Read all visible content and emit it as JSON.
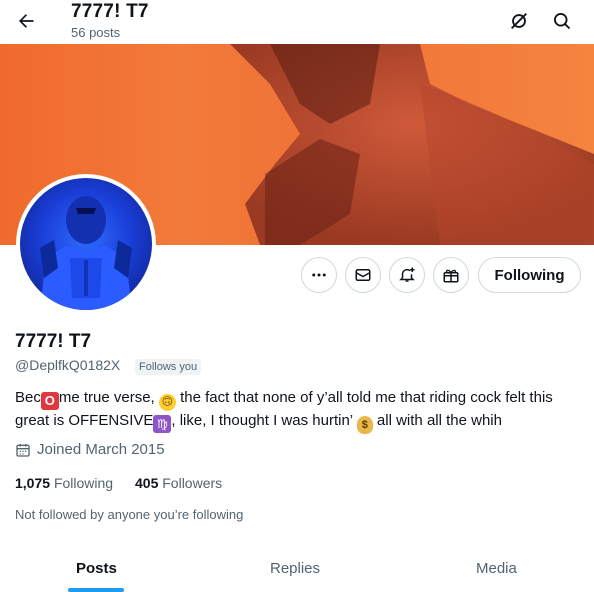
{
  "header": {
    "title": "7777! T7",
    "subtitle": "56 posts",
    "back_icon": "arrow-left-icon",
    "icons": [
      "no-signal-icon",
      "search-icon"
    ]
  },
  "profile": {
    "name": "7777! T7",
    "handle": "@DeplfkQ0182X",
    "follows_you": "Follows you",
    "bio_parts": {
      "p1": "Bec",
      "e1": "O",
      "p2": "me true verse,",
      "e2": "🙃",
      "p3": "the fact that none of y’all told me that riding cock felt this great is OFFENSIVE",
      "e3": "♍",
      "p4": ", like, I thought I was hurtin’",
      "e4": "$",
      "p5": "all with all the whih"
    },
    "joined": "Joined March 2015",
    "following_count": "1,075",
    "following_label": "Following",
    "followers_count": "405",
    "followers_label": "Followers",
    "followed_by": "Not followed by anyone you’re following"
  },
  "actions": {
    "buttons": [
      "more-icon",
      "message-icon",
      "notify-icon",
      "subscribe-icon"
    ],
    "following_label": "Following"
  },
  "tabs": [
    {
      "label": "Posts",
      "active": true
    },
    {
      "label": "Replies",
      "active": false
    },
    {
      "label": "Media",
      "active": false
    }
  ],
  "colors": {
    "accent": "#1d9bf0",
    "banner": "#f06a2d",
    "avatar_blue": "#1a3fd8",
    "secondary_text": "#536471"
  }
}
